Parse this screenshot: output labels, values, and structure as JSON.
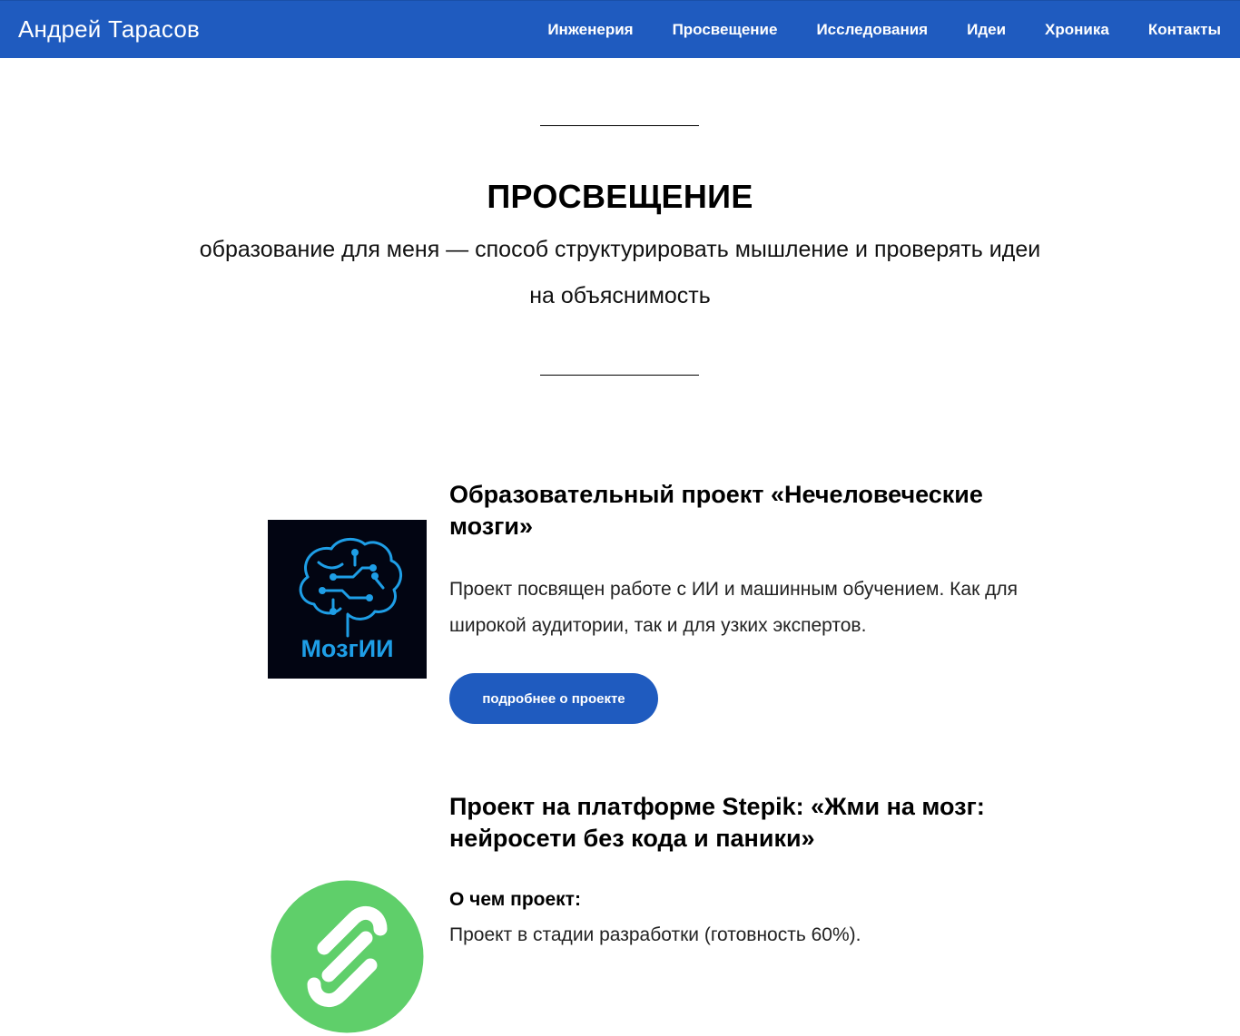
{
  "header": {
    "brand": "Андрей Тарасов",
    "nav": [
      {
        "label": "Инженерия"
      },
      {
        "label": "Просвещение"
      },
      {
        "label": "Исследования"
      },
      {
        "label": "Идеи"
      },
      {
        "label": "Хроника"
      },
      {
        "label": "Контакты"
      }
    ],
    "background_color": "#1f5bbf"
  },
  "hero": {
    "title": "ПРОСВЕЩЕНИЕ",
    "subtitle": "образование для меня — способ структурировать мышление и проверять идеи на объяснимость"
  },
  "projects": [
    {
      "title": "Образовательный проект «Нечеловеческие мозги»",
      "description": "Проект посвящен работе с ИИ и машинным обучением. Как для широкой аудитории, так и для узких экспертов.",
      "button_label": "подробнее о проекте",
      "logo_text": "МозгИИ",
      "logo_icon": "brain-circuit-icon",
      "logo_color": "#1e9ee6"
    },
    {
      "title": "Проект на платформе Stepik: «Жми на мозг: нейросети без кода и паники»",
      "about_heading": "О чем проект:",
      "about_text": "Проект в стадии разработки (готовность 60%).",
      "logo_icon": "stepik-logo-icon",
      "logo_color": "#5fcf6a"
    }
  ]
}
